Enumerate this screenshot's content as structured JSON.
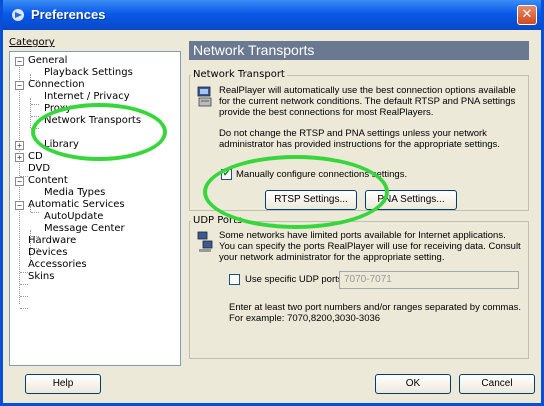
{
  "window": {
    "title": "Preferences",
    "close_glyph": "✕"
  },
  "category": {
    "label": "Category",
    "items": [
      {
        "label": "General",
        "expander": "−"
      },
      {
        "label": "Playback Settings"
      },
      {
        "label": "Connection",
        "expander": "−"
      },
      {
        "label": "Internet / Privacy"
      },
      {
        "label": "Proxy"
      },
      {
        "label": "Network Transports"
      },
      {
        "label": "Library",
        "expander": "+"
      },
      {
        "label": "CD",
        "expander": "+"
      },
      {
        "label": "DVD"
      },
      {
        "label": "Content",
        "expander": "−"
      },
      {
        "label": "Media Types"
      },
      {
        "label": "Automatic Services",
        "expander": "−"
      },
      {
        "label": "AutoUpdate"
      },
      {
        "label": "Message Center"
      },
      {
        "label": "Hardware"
      },
      {
        "label": "Devices"
      },
      {
        "label": "Accessories"
      },
      {
        "label": "Skins"
      }
    ]
  },
  "panel": {
    "heading": "Network Transports",
    "network_transport": {
      "group_label": "Network Transport",
      "description_1": "RealPlayer will automatically use the best connection options available for the current network conditions.  The default RTSP and PNA settings provide the best connections for most RealPlayers.",
      "description_2": "Do not change the RTSP and PNA settings unless your network administrator has provided instructions for the appropriate settings.",
      "manual_checkbox_label": "Manually configure connections settings.",
      "manual_checked": true,
      "rtsp_button": "RTSP Settings...",
      "pna_button": "PNA Settings..."
    },
    "udp_ports": {
      "group_label": "UDP Ports",
      "description": "Some networks have limited ports available for Internet applications. You can specify the ports RealPlayer will use for receiving data. Consult your network administrator for the appropriate setting.",
      "use_checkbox_label": "Use specific UDP ports:",
      "use_checked": false,
      "ports_value": "7070-7071",
      "hint": "Enter at least two port numbers and/or ranges separated by commas. For example: 7070,8200,3030-3036"
    }
  },
  "footer": {
    "help": "Help",
    "ok": "OK",
    "cancel": "Cancel"
  },
  "colors": {
    "title_bar": "#0a5ae8",
    "panel_header": "#6a7890",
    "highlight_ellipse": "#37d63b"
  }
}
